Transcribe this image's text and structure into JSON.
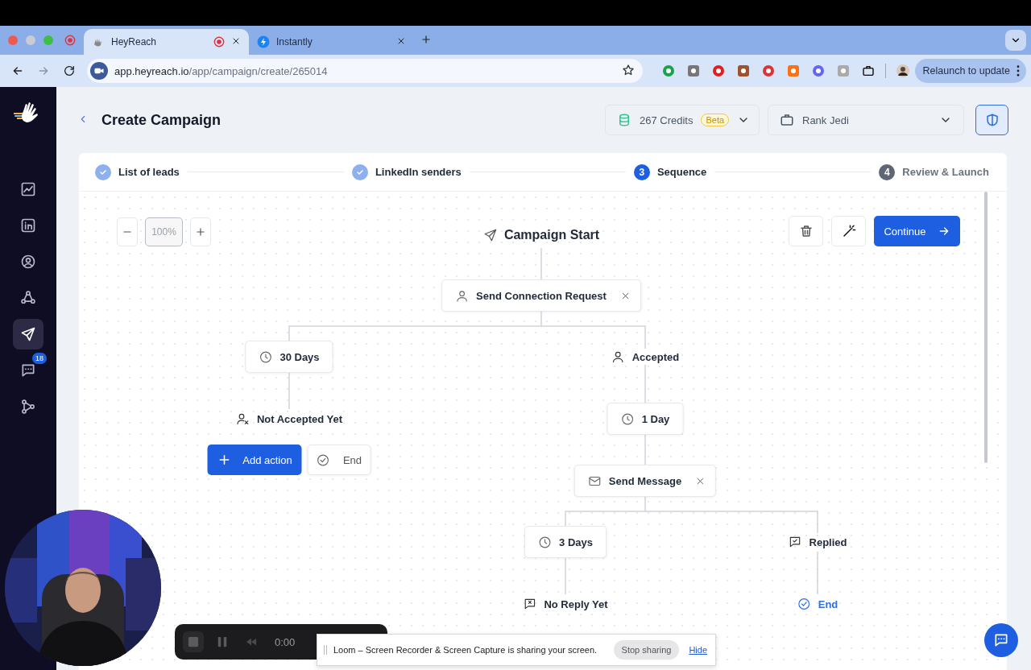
{
  "browser": {
    "tabs": [
      {
        "title": "HeyReach",
        "selected": true,
        "recording": true
      },
      {
        "title": "Instantly",
        "selected": false,
        "recording": false
      }
    ],
    "url": {
      "host": "app.heyreach.io",
      "path": "/app/campaign/create/265014"
    },
    "update_button": "Relaunch to update"
  },
  "sidebar": {
    "items": [
      {
        "selected": false
      },
      {
        "selected": false
      },
      {
        "selected": false
      },
      {
        "selected": false
      },
      {
        "selected": true
      },
      {
        "selected": false,
        "badge": "18"
      },
      {
        "selected": false
      }
    ]
  },
  "header": {
    "title": "Create Campaign",
    "credits": "267 Credits",
    "credits_badge": "Beta",
    "workspace": "Rank Jedi"
  },
  "steps": [
    {
      "label": "List of leads",
      "completed": true,
      "current": false
    },
    {
      "label": "LinkedIn senders",
      "completed": true,
      "current": false
    },
    {
      "label": "Sequence",
      "completed": false,
      "current": true,
      "number": "3"
    },
    {
      "label": "Review & Launch",
      "completed": false,
      "current": false,
      "number": "4"
    }
  ],
  "canvas": {
    "zoom": "100%",
    "continue_button": "Continue",
    "nodes": [
      {
        "kind": "start",
        "label": "Campaign Start"
      },
      {
        "kind": "action",
        "label": "Send Connection Request"
      },
      {
        "kind": "delay",
        "label": "30 Days"
      },
      {
        "kind": "condition",
        "label": "Accepted"
      },
      {
        "kind": "condition",
        "label": "Not Accepted Yet"
      },
      {
        "kind": "delay",
        "label": "1 Day"
      },
      {
        "kind": "add",
        "label": "Add action"
      },
      {
        "kind": "end_button",
        "label": "End"
      },
      {
        "kind": "action",
        "label": "Send Message"
      },
      {
        "kind": "delay",
        "label": "3 Days"
      },
      {
        "kind": "condition",
        "label": "Replied"
      },
      {
        "kind": "condition",
        "label": "No Reply Yet"
      },
      {
        "kind": "end",
        "label": "End"
      }
    ]
  },
  "loom": {
    "timer": "0:00",
    "message": "Loom – Screen Recorder & Screen Capture is sharing your screen.",
    "stop_button": "Stop sharing",
    "hide_link": "Hide"
  }
}
